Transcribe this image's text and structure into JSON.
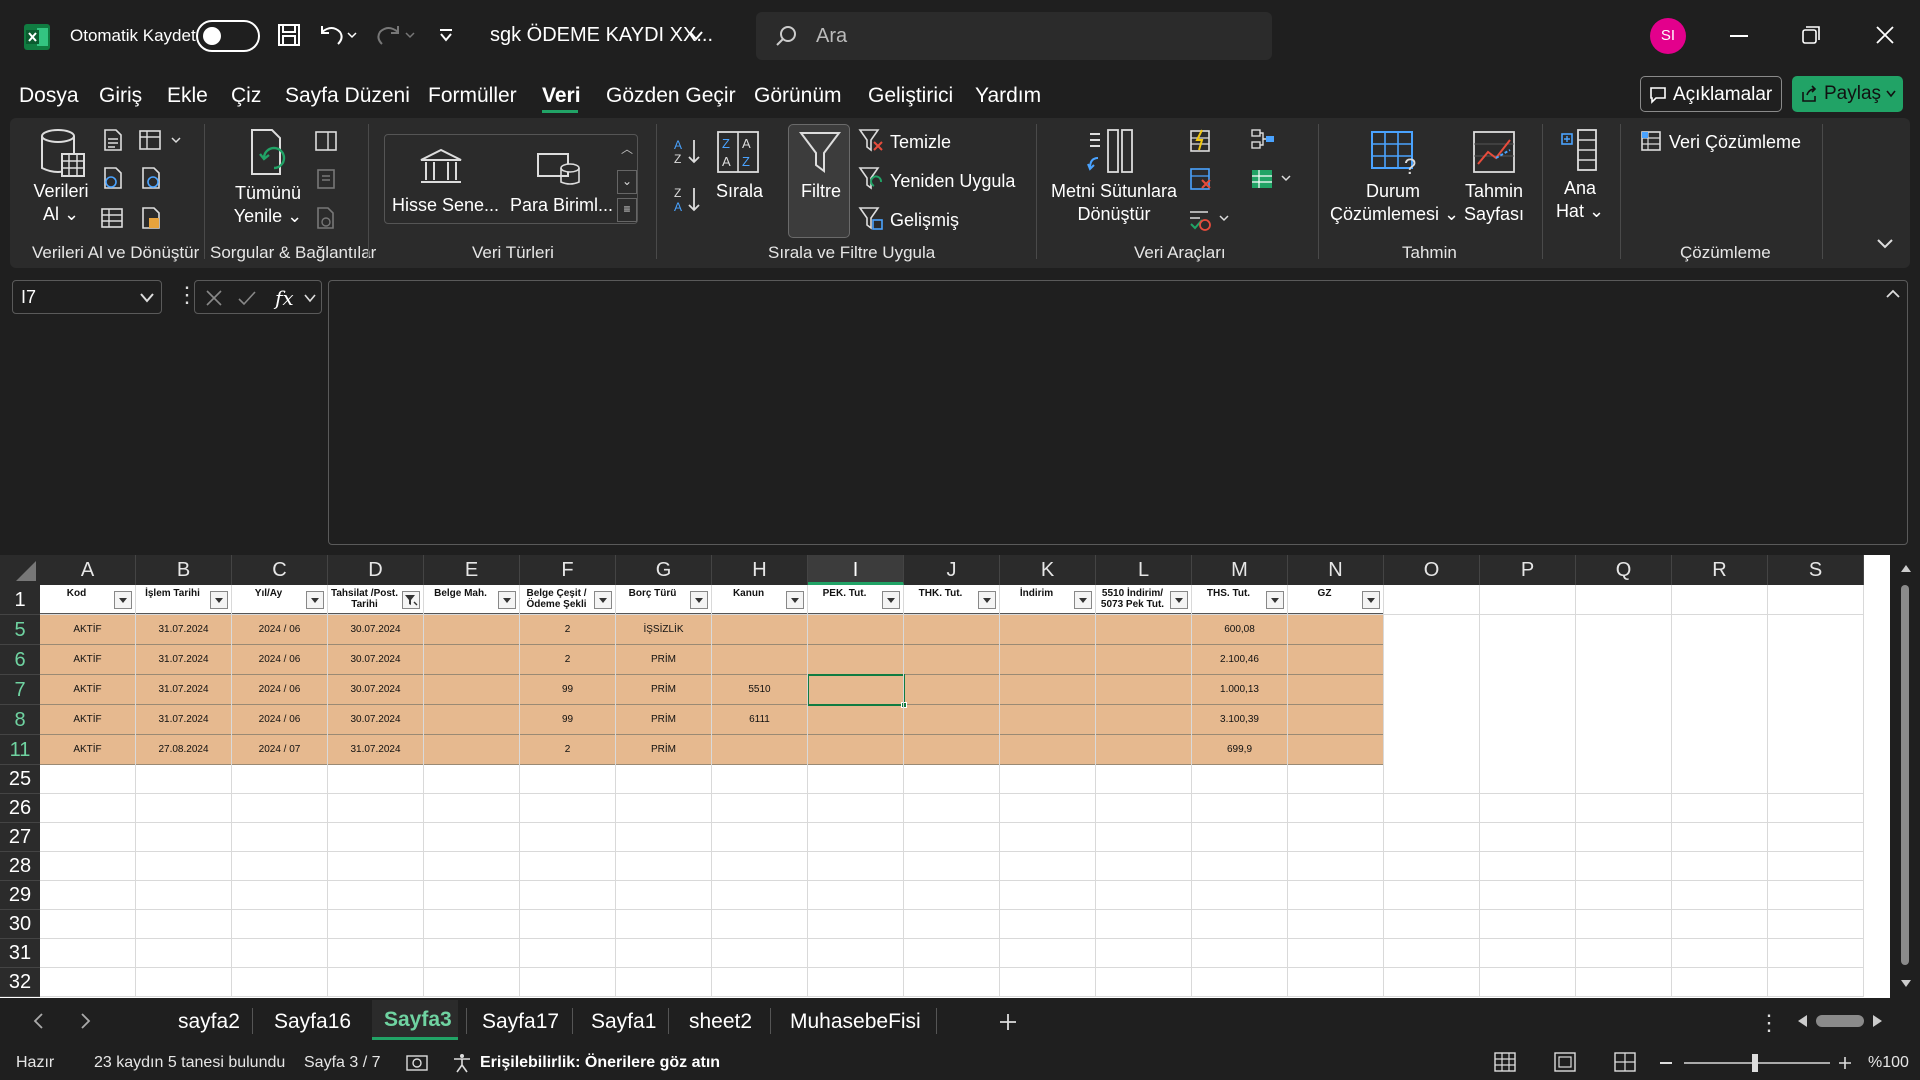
{
  "titlebar": {
    "autosave_label": "Otomatik Kaydet",
    "doc_title": "sgk ÖDEME KAYDI XX...",
    "search_placeholder": "Ara",
    "avatar_initials": "SI"
  },
  "menu": [
    "Dosya",
    "Giriş",
    "Ekle",
    "Çiz",
    "Sayfa Düzeni",
    "Formüller",
    "Veri",
    "Gözden Geçir",
    "Görünüm",
    "Geliştirici",
    "Yardım"
  ],
  "menu_active": "Veri",
  "top_buttons": {
    "comments": "Açıklamalar",
    "share": "Paylaş"
  },
  "ribbon": {
    "get_data": [
      "Verileri",
      "Al"
    ],
    "refresh_all": [
      "Tümünü",
      "Yenile"
    ],
    "stocks": "Hisse Sene...",
    "currencies": "Para Biriml...",
    "sort": "Sırala",
    "filter": "Filtre",
    "clear": "Temizle",
    "reapply": "Yeniden Uygula",
    "advanced": "Gelişmiş",
    "text_to_columns": [
      "Metni Sütunlara",
      "Dönüştür"
    ],
    "what_if": [
      "Durum",
      "Çözümlemesi"
    ],
    "forecast_sheet": [
      "Tahmin",
      "Sayfası"
    ],
    "outline": [
      "Ana",
      "Hat"
    ],
    "data_analysis": "Veri Çözümleme",
    "groups": {
      "get_transform": "Verileri Al ve Dönüştür",
      "queries": "Sorgular & Bağlantılar",
      "data_types": "Veri Türleri",
      "sort_filter": "Sırala ve Filtre Uygula",
      "data_tools": "Veri Araçları",
      "forecast": "Tahmin",
      "analysis": "Çözümleme"
    }
  },
  "formula": {
    "name_box": "I7",
    "fx": "fx",
    "content": ""
  },
  "columns": [
    "A",
    "B",
    "C",
    "D",
    "E",
    "F",
    "G",
    "H",
    "I",
    "J",
    "K",
    "L",
    "M",
    "N",
    "O",
    "P",
    "Q",
    "R",
    "S"
  ],
  "selected_column": "I",
  "header_row": {
    "row_number": "1",
    "cells": [
      "Kod",
      "İşlem Tarihi",
      "Yıl/Ay",
      "Tahsilat /Post. Tarihi",
      "Belge Mah.",
      "Belge Çeşit / Ödeme Şekli",
      "Borç Türü",
      "Kanun",
      "PEK. Tut.",
      "THK. Tut.",
      "İndirim",
      "5510 İndirim/ 5073 Pek Tut.",
      "THS. Tut.",
      "GZ"
    ]
  },
  "data_rows": [
    {
      "row": "5",
      "cells": [
        "AKTİF",
        "31.07.2024",
        "2024 / 06",
        "30.07.2024",
        "",
        "2",
        "İŞSİZLİK",
        "",
        "",
        "",
        "",
        "",
        "600,08",
        ""
      ]
    },
    {
      "row": "6",
      "cells": [
        "AKTİF",
        "31.07.2024",
        "2024 / 06",
        "30.07.2024",
        "",
        "2",
        "PRİM",
        "",
        "",
        "",
        "",
        "",
        "2.100,46",
        ""
      ]
    },
    {
      "row": "7",
      "cells": [
        "AKTİF",
        "31.07.2024",
        "2024 / 06",
        "30.07.2024",
        "",
        "99",
        "PRİM",
        "5510",
        "",
        "",
        "",
        "",
        "1.000,13",
        ""
      ]
    },
    {
      "row": "8",
      "cells": [
        "AKTİF",
        "31.07.2024",
        "2024 / 06",
        "30.07.2024",
        "",
        "99",
        "PRİM",
        "6111",
        "",
        "",
        "",
        "",
        "3.100,39",
        ""
      ]
    },
    {
      "row": "11",
      "cells": [
        "AKTİF",
        "27.08.2024",
        "2024 / 07",
        "31.07.2024",
        "",
        "2",
        "PRİM",
        "",
        "",
        "",
        "",
        "",
        "699,9",
        ""
      ]
    }
  ],
  "empty_rows": [
    "25",
    "26",
    "27",
    "28",
    "29",
    "30",
    "31",
    "32"
  ],
  "sheets": [
    "sayfa2",
    "Sayfa16",
    "Sayfa3",
    "Sayfa17",
    "Sayfa1",
    "sheet2",
    "MuhasebeFisi"
  ],
  "active_sheet": "Sayfa3",
  "status": {
    "ready": "Hazır",
    "filter_result": "23 kaydın 5 tanesi bulundu",
    "page": "Sayfa 3 / 7",
    "accessibility": "Erişilebilirlik: Önerilere göz atın",
    "zoom": "%100"
  },
  "colors": {
    "data_fill": "#e6b98f",
    "accent": "#21a366",
    "avatar": "#e3008c"
  }
}
